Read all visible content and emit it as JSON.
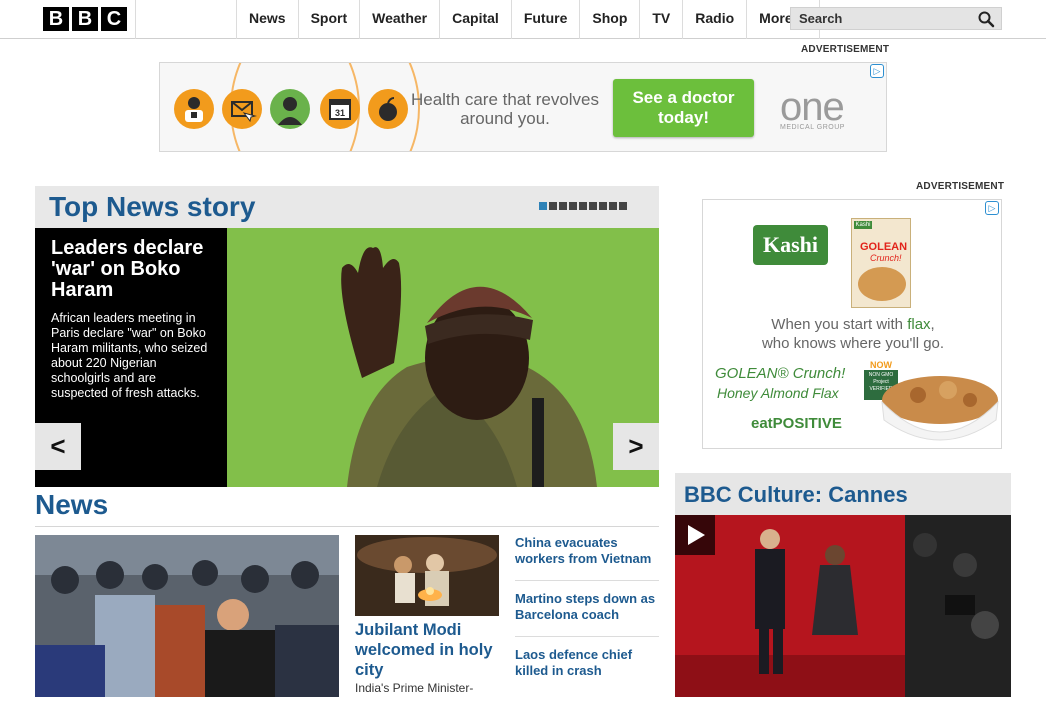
{
  "header": {
    "logo_letters": [
      "B",
      "B",
      "C"
    ],
    "nav": [
      "News",
      "Sport",
      "Weather",
      "Capital",
      "Future",
      "Shop",
      "TV",
      "Radio",
      "More…"
    ],
    "search_label": "Search",
    "search_icon": "magnifier-icon"
  },
  "ad_top": {
    "label": "ADVERTISEMENT",
    "tagline": "Health care that revolves around you.",
    "cta": "See a doctor today!",
    "brand": "one",
    "brand_sub": "MEDICAL GROUP",
    "icons": [
      "doctor-icon",
      "email-icon",
      "person-icon",
      "calendar-icon",
      "apple-icon"
    ],
    "calendar_day": "31"
  },
  "top_news": {
    "title": "Top News story",
    "slide_count": 9,
    "active_slide": 0,
    "headline": "Leaders declare 'war' on Boko Haram",
    "summary": "African leaders meeting in Paris declare \"war\" on Boko Haram militants, who seized about 220 Nigerian schoolgirls and are suspected of fresh attacks.",
    "prev_glyph": "<",
    "next_glyph": ">"
  },
  "news": {
    "title": "News",
    "feature_headline": "Jubilant Modi welcomed in holy city",
    "feature_sub": "India's Prime Minister-",
    "links": [
      "China evacuates workers from Vietnam",
      "Martino steps down as Barcelona coach",
      "Laos defence chief killed in crash"
    ]
  },
  "ad_side": {
    "label": "ADVERTISEMENT",
    "brand": "Kashi",
    "box_brand": "Kashi",
    "box_title": "GOLEAN",
    "box_sub": "Crunch!",
    "line1_pre": "When you start with ",
    "line1_em": "flax",
    "line1_post": ",",
    "line2": "who knows where you'll go.",
    "now": "NOW",
    "badge": "NON GMO Project VERIFIED",
    "product1": "GOLEAN® Crunch!",
    "product2": "Honey Almond Flax",
    "footer": "eatPOSITIVE"
  },
  "culture": {
    "title": "BBC Culture: Cannes"
  },
  "colors": {
    "bbc_blue": "#1d5a8f",
    "cta_green": "#6cbf3c",
    "ad_orange": "#f29b1c",
    "carpet_red": "#b3141d"
  }
}
